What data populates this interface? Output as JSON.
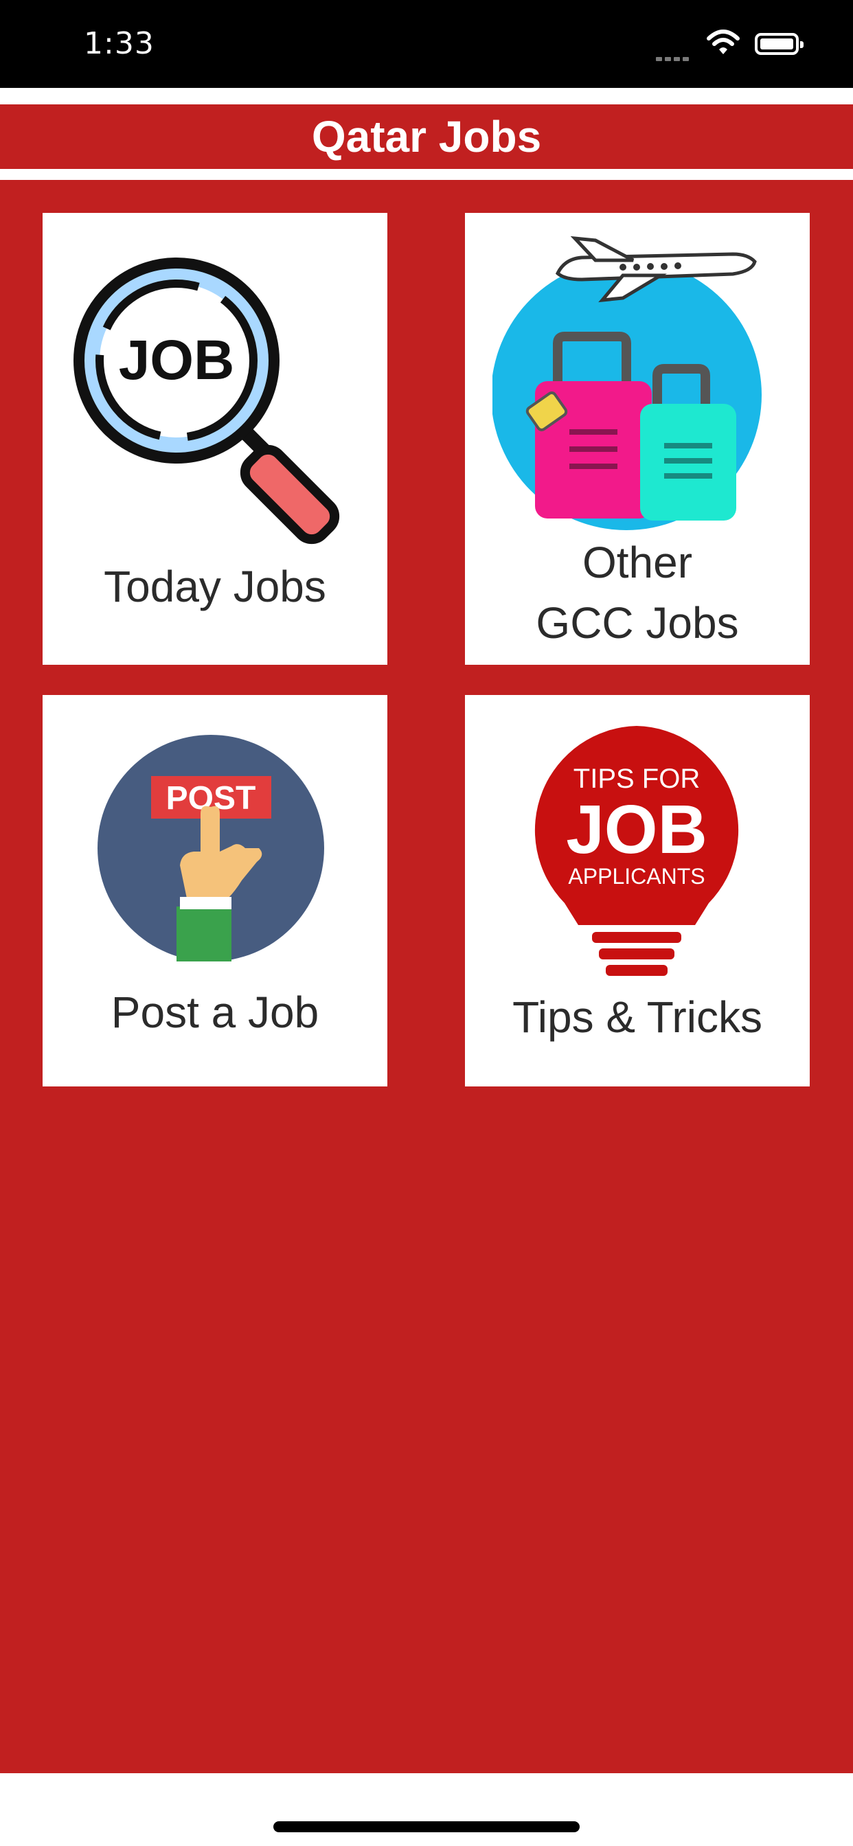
{
  "status_bar": {
    "time": "1:33"
  },
  "nav": {
    "title": "Qatar Jobs"
  },
  "tiles": [
    {
      "label": "Today Jobs",
      "icon": "job-search-magnifier-icon",
      "icon_text": "JOB"
    },
    {
      "label_line1": "Other",
      "label_line2": "GCC Jobs",
      "icon": "travel-luggage-airplane-icon"
    },
    {
      "label": "Post a Job",
      "icon": "post-hand-icon",
      "icon_text": "POST"
    },
    {
      "label": "Tips & Tricks",
      "icon": "tips-bulb-icon",
      "icon_text_1": "TIPS FOR",
      "icon_text_2": "JOB",
      "icon_text_3": "APPLICANTS"
    }
  ],
  "colors": {
    "brand_red": "#c12020",
    "tile_bg": "#ffffff",
    "text": "#2b2b2b"
  }
}
